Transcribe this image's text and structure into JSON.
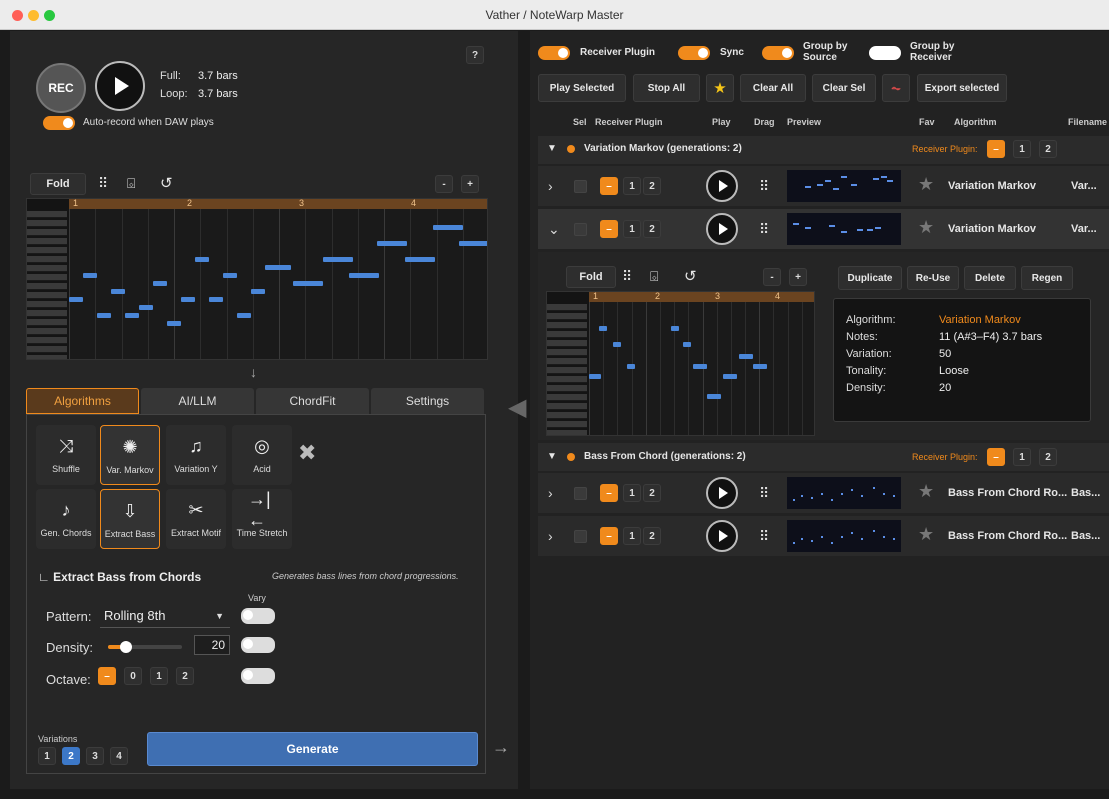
{
  "window": {
    "title": "Vather / NoteWarp Master",
    "traffic_colors": [
      "#ff5f57",
      "#febc2e",
      "#28c840"
    ]
  },
  "left": {
    "help_label": "?",
    "rec_label": "REC",
    "full_label": "Full:",
    "full_value": "3.7 bars",
    "loop_label": "Loop:",
    "loop_value": "3.7 bars",
    "auto_record_label": "Auto-record when DAW plays",
    "fold_label": "Fold",
    "zoom_out": "-",
    "zoom_in": "+",
    "ruler_bars": [
      "1",
      "2",
      "3",
      "4"
    ],
    "tabs": [
      "Algorithms",
      "AI/LLM",
      "ChordFit",
      "Settings"
    ],
    "algorithms": [
      {
        "label": "Shuffle",
        "icon": "shuffle-icon",
        "glyph": "⤨",
        "selected": false
      },
      {
        "label": "Var. Markov",
        "icon": "markov-icon",
        "glyph": "✺",
        "selected": true
      },
      {
        "label": "Variation Y",
        "icon": "variation-y-icon",
        "glyph": "♫",
        "selected": false
      },
      {
        "label": "Acid",
        "icon": "acid-icon",
        "glyph": "◎",
        "selected": false
      },
      {
        "label": "Gen. Chords",
        "icon": "chords-icon",
        "glyph": "♪",
        "selected": false
      },
      {
        "label": "Extract Bass",
        "icon": "extract-bass-icon",
        "glyph": "⇩",
        "selected": true
      },
      {
        "label": "Extract Motif",
        "icon": "extract-motif-icon",
        "glyph": "✂",
        "selected": false
      },
      {
        "label": "Time Stretch",
        "icon": "time-stretch-icon",
        "glyph": "→|←",
        "selected": false
      }
    ],
    "section_title": "Extract Bass from Chords",
    "section_desc": "Generates bass lines from chord progressions.",
    "vary_label": "Vary",
    "pattern_label": "Pattern:",
    "pattern_value": "Rolling 8th",
    "density_label": "Density:",
    "density_value": "20",
    "octave_label": "Octave:",
    "octave_options": [
      "–",
      "0",
      "1",
      "2"
    ],
    "variations_label": "Variations",
    "variations_options": [
      "1",
      "2",
      "3",
      "4"
    ],
    "generate_label": "Generate"
  },
  "right": {
    "toggles": {
      "receiver_plugin": "Receiver Plugin",
      "sync": "Sync",
      "group_by_source_1": "Group by",
      "group_by_source_2": "Source",
      "group_by_receiver_1": "Group by",
      "group_by_receiver_2": "Receiver"
    },
    "toolbar": {
      "play_selected": "Play Selected",
      "stop_all": "Stop All",
      "clear_all": "Clear All",
      "clear_sel": "Clear Sel",
      "export_selected": "Export selected"
    },
    "columns": [
      "Sel",
      "Receiver Plugin",
      "Play",
      "Drag",
      "Preview",
      "Fav",
      "Algorithm",
      "Filename"
    ],
    "group1": {
      "title": "Variation Markov (generations: 2)",
      "receiver_label": "Receiver Plugin:",
      "options": [
        "–",
        "1",
        "2"
      ]
    },
    "group2": {
      "title": "Bass From Chord (generations: 2)",
      "receiver_label": "Receiver Plugin:",
      "options": [
        "–",
        "1",
        "2"
      ]
    },
    "rows": [
      {
        "algorithm": "Variation Markov",
        "filename": "Var..."
      },
      {
        "algorithm": "Variation Markov",
        "filename": "Var..."
      },
      {
        "algorithm": "Bass From Chord Ro...",
        "filename": "Bas..."
      },
      {
        "algorithm": "Bass From Chord Ro...",
        "filename": "Bas..."
      }
    ],
    "detail": {
      "fold_label": "Fold",
      "zoom_out": "-",
      "zoom_in": "+",
      "ruler_bars": [
        "1",
        "2",
        "3",
        "4"
      ],
      "duplicate": "Duplicate",
      "reuse": "Re-Use",
      "delete": "Delete",
      "regen": "Regen",
      "info": [
        {
          "k": "Algorithm:",
          "v": "Variation Markov"
        },
        {
          "k": "Notes:",
          "v": "11 (A#3–F4)  3.7 bars"
        },
        {
          "k": "Variation:",
          "v": "50"
        },
        {
          "k": "Tonality:",
          "v": "Loose"
        },
        {
          "k": "Density:",
          "v": "20"
        }
      ]
    }
  }
}
